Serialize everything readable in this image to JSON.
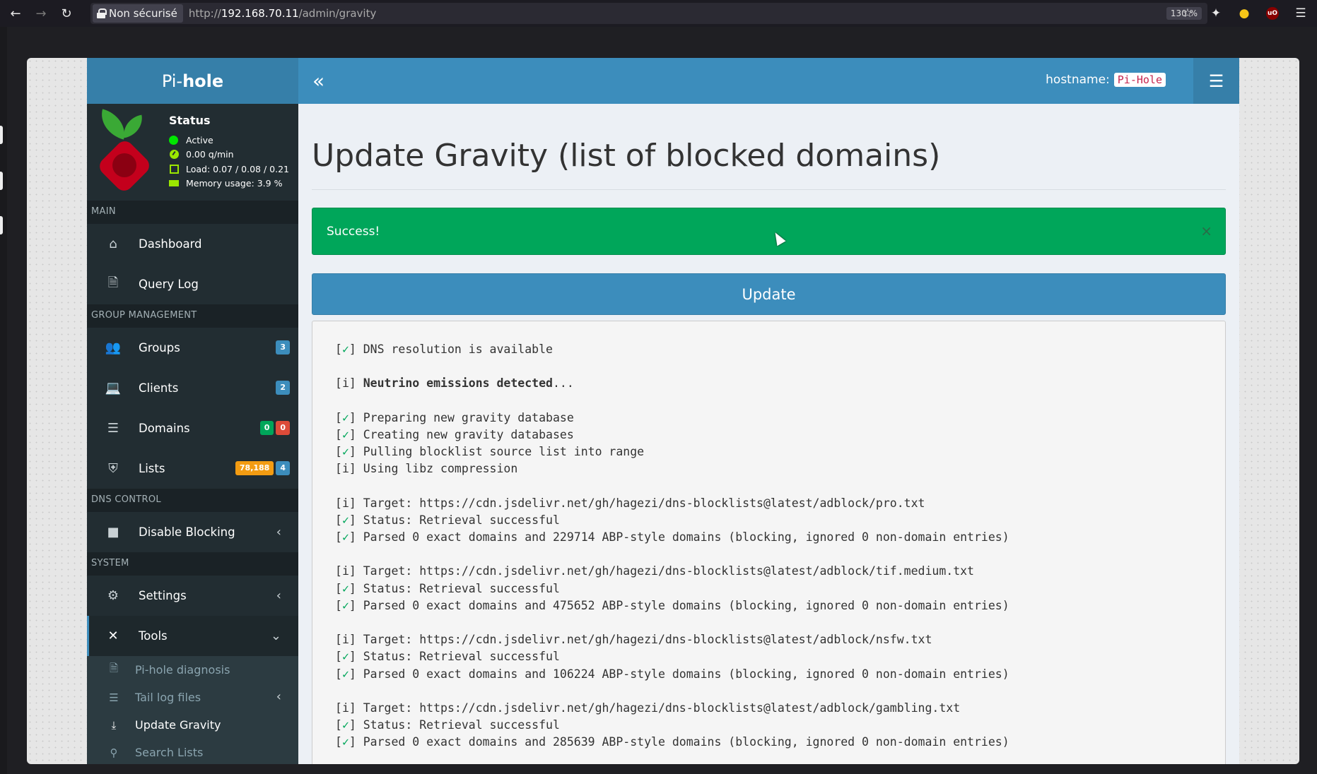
{
  "browser": {
    "insecure_label": "Non sécurisé",
    "url_prefix": "http://",
    "url_host": "192.168.70.11",
    "url_path": "/admin/gravity",
    "zoom": "130 %"
  },
  "sidebar": {
    "brand_prefix": "Pi-",
    "brand_bold": "hole",
    "status": {
      "title": "Status",
      "active": "Active",
      "rate": "0.00 q/min",
      "load": "Load: 0.07 / 0.08 / 0.21",
      "memory": "Memory usage: 3.9 %"
    },
    "sections": {
      "main": "MAIN",
      "group": "GROUP MANAGEMENT",
      "dns": "DNS CONTROL",
      "system": "SYSTEM"
    },
    "items": {
      "dashboard": "Dashboard",
      "query_log": "Query Log",
      "groups": "Groups",
      "groups_count": "3",
      "clients": "Clients",
      "clients_count": "2",
      "domains": "Domains",
      "domains_allow": "0",
      "domains_deny": "0",
      "lists": "Lists",
      "lists_domains": "78,188",
      "lists_count": "4",
      "disable_blocking": "Disable Blocking",
      "settings": "Settings",
      "tools": "Tools"
    },
    "tools_sub": {
      "diagnosis": "Pi-hole diagnosis",
      "tail": "Tail log files",
      "gravity": "Update Gravity",
      "search": "Search Lists"
    }
  },
  "header": {
    "hostname_label": "hostname:",
    "hostname_value": "Pi-Hole"
  },
  "content": {
    "title": "Update Gravity (list of blocked domains)",
    "alert": "Success!",
    "update_button": "Update"
  },
  "output_lines": [
    {
      "tag": "✓",
      "text": "DNS resolution is available"
    },
    {
      "gap": true
    },
    {
      "tag": "i",
      "bold": "Neutrino emissions detected",
      "text": "..."
    },
    {
      "gap": true
    },
    {
      "tag": "✓",
      "text": "Preparing new gravity database"
    },
    {
      "tag": "✓",
      "text": "Creating new gravity databases"
    },
    {
      "tag": "✓",
      "text": "Pulling blocklist source list into range"
    },
    {
      "tag": "i",
      "text": "Using libz compression"
    },
    {
      "gap": true
    },
    {
      "tag": "i",
      "text": "Target: https://cdn.jsdelivr.net/gh/hagezi/dns-blocklists@latest/adblock/pro.txt"
    },
    {
      "tag": "✓",
      "text": "Status: Retrieval successful"
    },
    {
      "tag": "✓",
      "text": "Parsed 0 exact domains and 229714 ABP-style domains (blocking, ignored 0 non-domain entries)"
    },
    {
      "gap": true
    },
    {
      "tag": "i",
      "text": "Target: https://cdn.jsdelivr.net/gh/hagezi/dns-blocklists@latest/adblock/tif.medium.txt"
    },
    {
      "tag": "✓",
      "text": "Status: Retrieval successful"
    },
    {
      "tag": "✓",
      "text": "Parsed 0 exact domains and 475652 ABP-style domains (blocking, ignored 0 non-domain entries)"
    },
    {
      "gap": true
    },
    {
      "tag": "i",
      "text": "Target: https://cdn.jsdelivr.net/gh/hagezi/dns-blocklists@latest/adblock/nsfw.txt"
    },
    {
      "tag": "✓",
      "text": "Status: Retrieval successful"
    },
    {
      "tag": "✓",
      "text": "Parsed 0 exact domains and 106224 ABP-style domains (blocking, ignored 0 non-domain entries)"
    },
    {
      "gap": true
    },
    {
      "tag": "i",
      "text": "Target: https://cdn.jsdelivr.net/gh/hagezi/dns-blocklists@latest/adblock/gambling.txt"
    },
    {
      "tag": "✓",
      "text": "Status: Retrieval successful"
    },
    {
      "tag": "✓",
      "text": "Parsed 0 exact domains and 285639 ABP-style domains (blocking, ignored 0 non-domain entries)"
    }
  ],
  "colors": {
    "primary": "#3c8dbc",
    "success": "#00a65a",
    "sidebar": "#222d32"
  }
}
